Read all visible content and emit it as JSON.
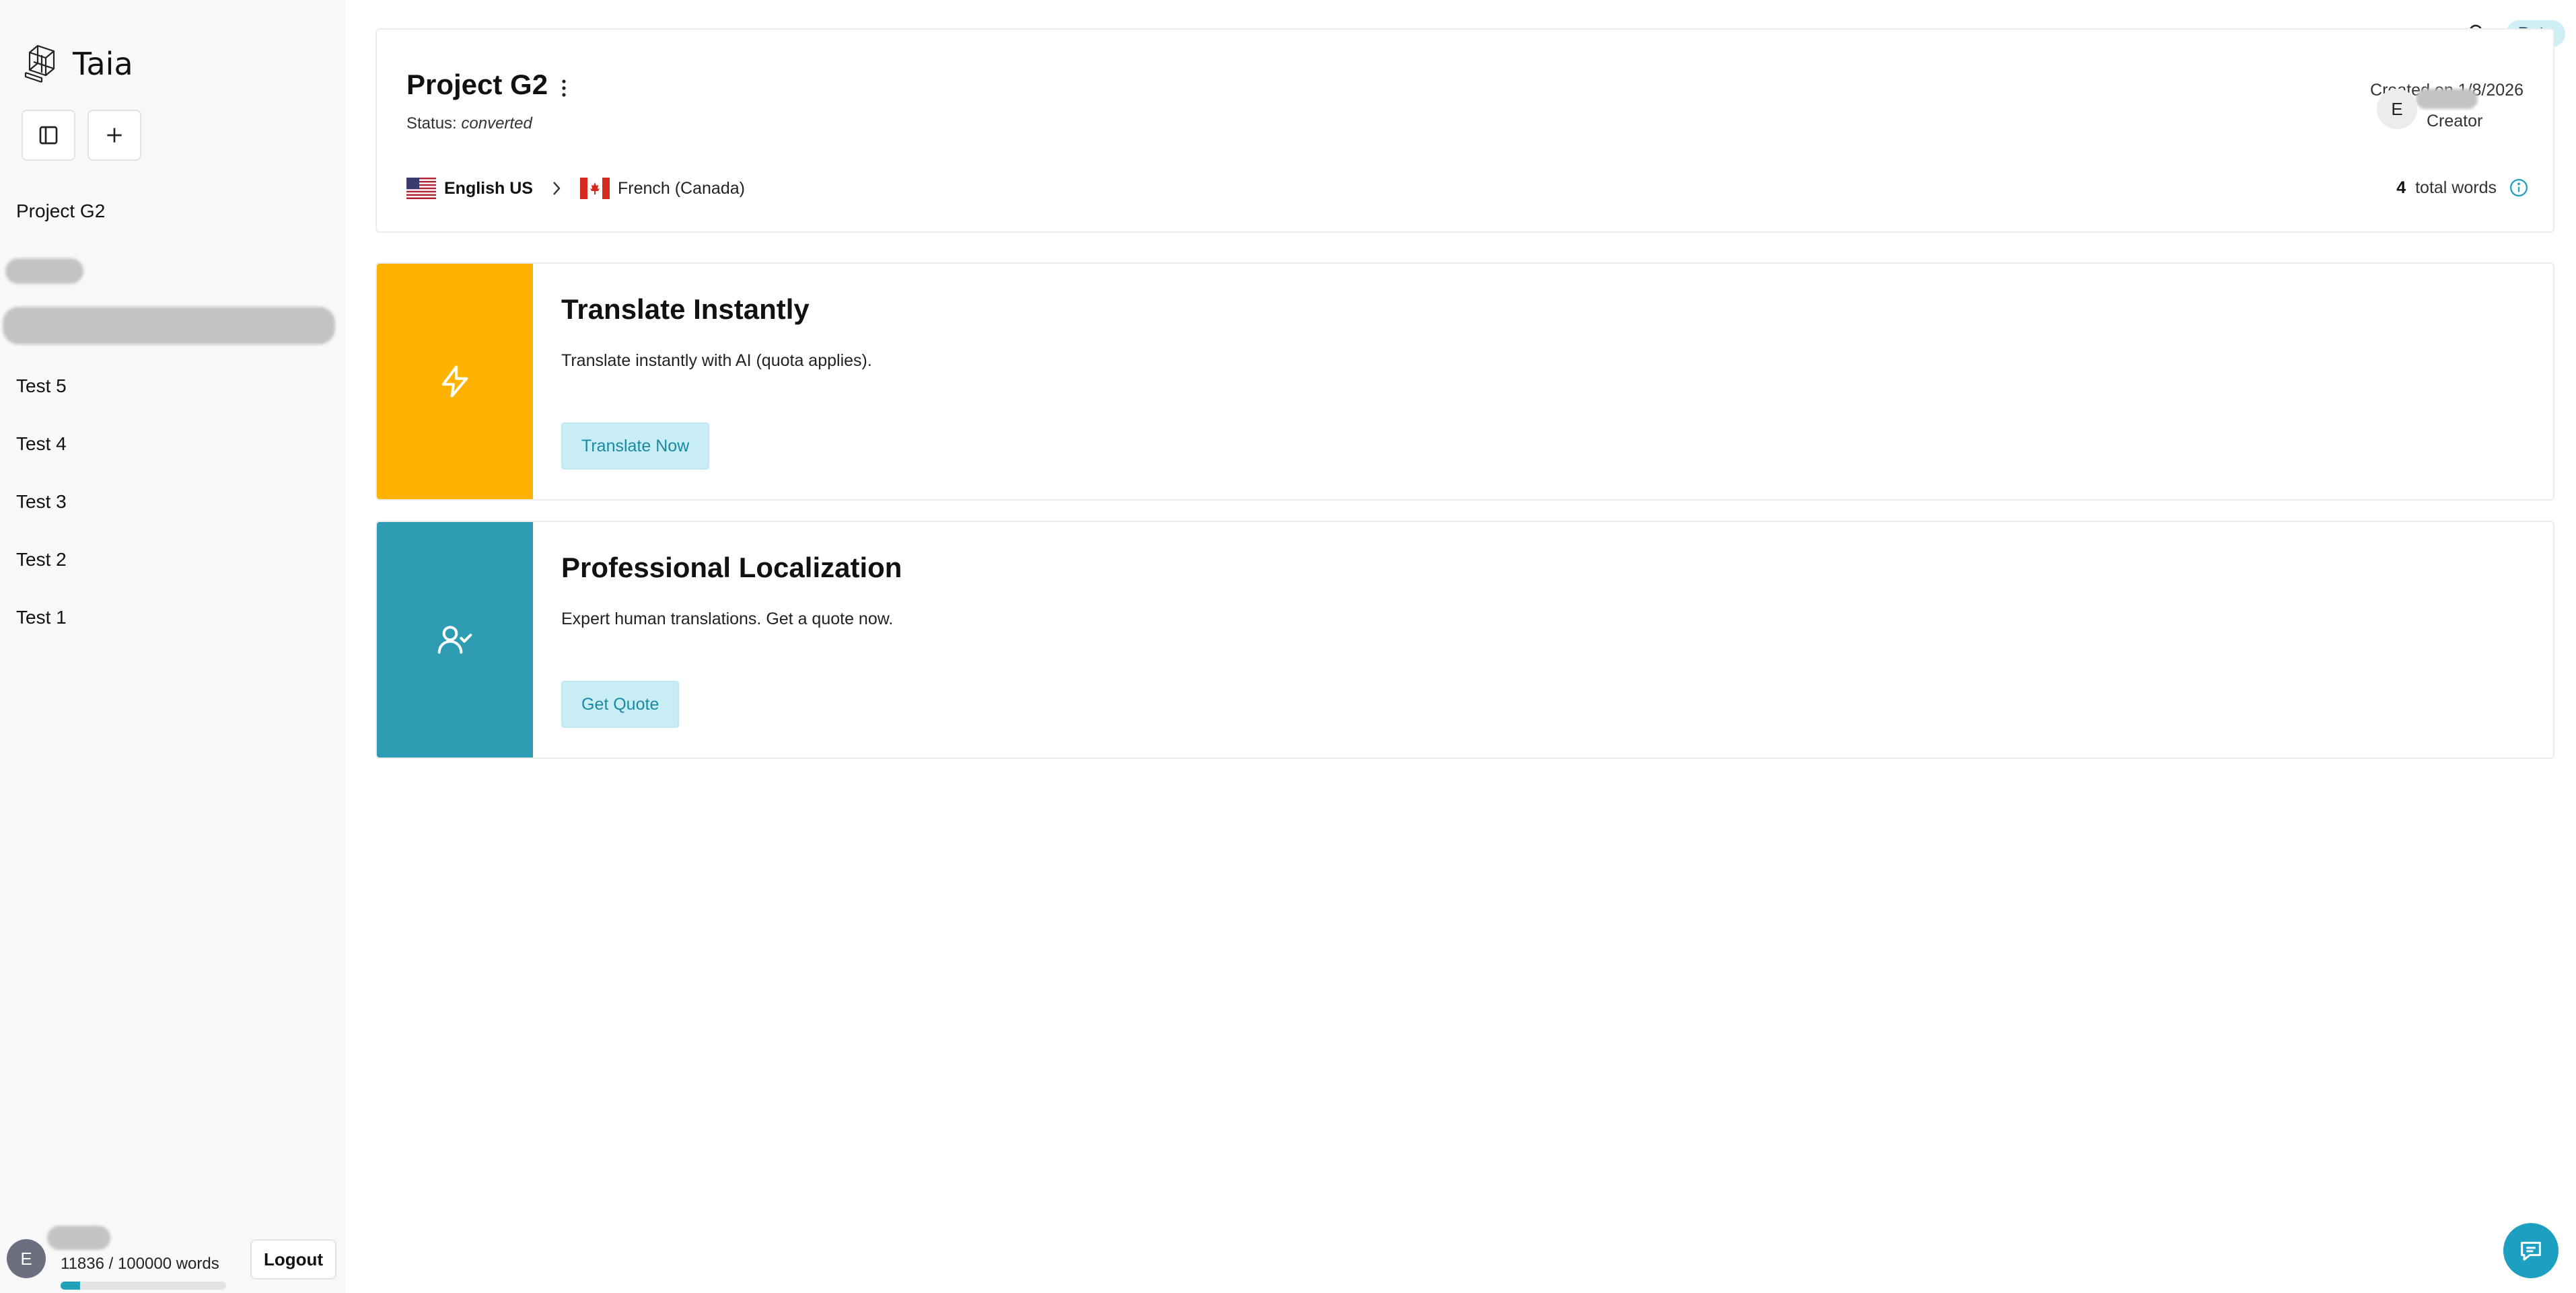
{
  "app": {
    "name": "Taia",
    "beta_label": "Beta"
  },
  "sidebar": {
    "toggle_icon": "sidebar-toggle-icon",
    "new_icon": "plus-icon",
    "items": [
      {
        "label": "Project G2"
      },
      {
        "label": "Test 5"
      },
      {
        "label": "Test 4"
      },
      {
        "label": "Test 3"
      },
      {
        "label": "Test 2"
      },
      {
        "label": "Test 1"
      }
    ],
    "footer": {
      "avatar_initial": "E",
      "usage_text": "11836 / 100000 words",
      "usage_fraction": 0.118,
      "logout_label": "Logout"
    }
  },
  "project": {
    "title": "Project G2",
    "status_label": "Status:",
    "status_value": "converted",
    "created": "Created on 1/8/2026",
    "creator_initial": "E",
    "creator_label": "Creator",
    "source_language": "English US",
    "target_language": "French (Canada)",
    "word_count": "4",
    "word_count_label": "total words"
  },
  "options": [
    {
      "title": "Translate Instantly",
      "description": "Translate instantly with AI (quota applies).",
      "button": "Translate Now",
      "accent_color": "#ffb300",
      "icon": "lightning-icon"
    },
    {
      "title": "Professional Localization",
      "description": "Expert human translations. Get a quote now.",
      "button": "Get Quote",
      "accent_color": "#2e9cb3",
      "icon": "user-check-icon"
    }
  ],
  "colors": {
    "brand_accent": "#22a2b8",
    "button_bg": "#c8edf4",
    "button_text": "#1a8aa3"
  }
}
